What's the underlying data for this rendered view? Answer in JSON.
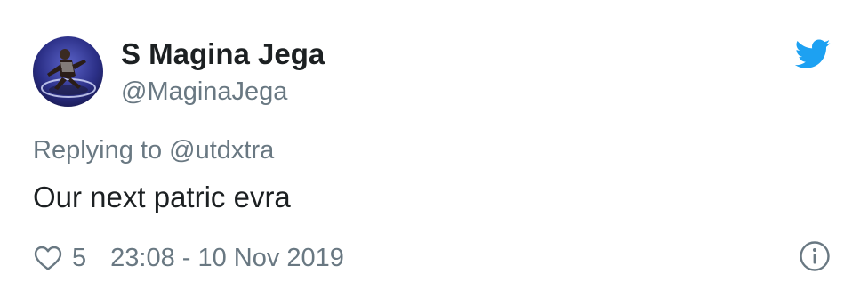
{
  "tweet": {
    "author": {
      "display_name": "S Magina Jega",
      "handle": "@MaginaJega",
      "avatar_icon": "avatar-image"
    },
    "reply_context": "Replying to @utdxtra",
    "text": "Our next patric evra",
    "likes": "5",
    "timestamp": "23:08 - 10 Nov 2019",
    "icons": {
      "brand": "twitter-bird-icon",
      "like": "heart-icon",
      "info": "info-icon"
    },
    "colors": {
      "brand": "#1da1f2",
      "text": "#1c2022",
      "muted": "#697882",
      "background": "#ffffff"
    }
  }
}
